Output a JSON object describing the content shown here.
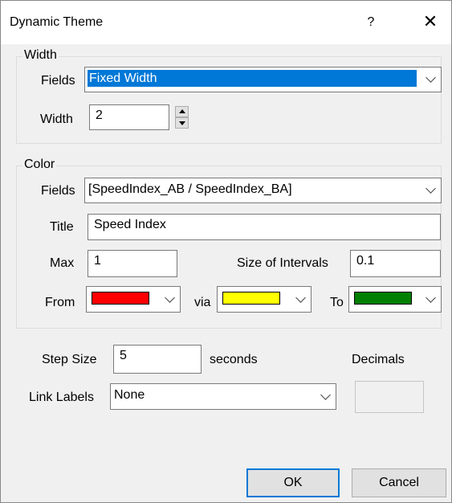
{
  "window": {
    "title": "Dynamic Theme",
    "help_glyph": "?",
    "close_glyph": "✕"
  },
  "width_group": {
    "legend": "Width",
    "fields_label": "Fields",
    "fields_value": "Fixed Width",
    "width_label": "Width",
    "width_value": "2"
  },
  "color_group": {
    "legend": "Color",
    "fields_label": "Fields",
    "fields_value": "[SpeedIndex_AB / SpeedIndex_BA]",
    "title_label": "Title",
    "title_value": "Speed Index",
    "max_label": "Max",
    "max_value": "1",
    "interval_label": "Size of Intervals",
    "interval_value": "0.1",
    "from_label": "From",
    "via_label": "via",
    "to_label": "To",
    "colors": {
      "from": "#ff0000",
      "via": "#ffff00",
      "to": "#008000"
    }
  },
  "step": {
    "label": "Step Size",
    "value": "5",
    "unit": "seconds"
  },
  "decimals": {
    "label": "Decimals",
    "value": ""
  },
  "link_labels": {
    "label": "Link Labels",
    "value": "None"
  },
  "buttons": {
    "ok": "OK",
    "cancel": "Cancel"
  }
}
